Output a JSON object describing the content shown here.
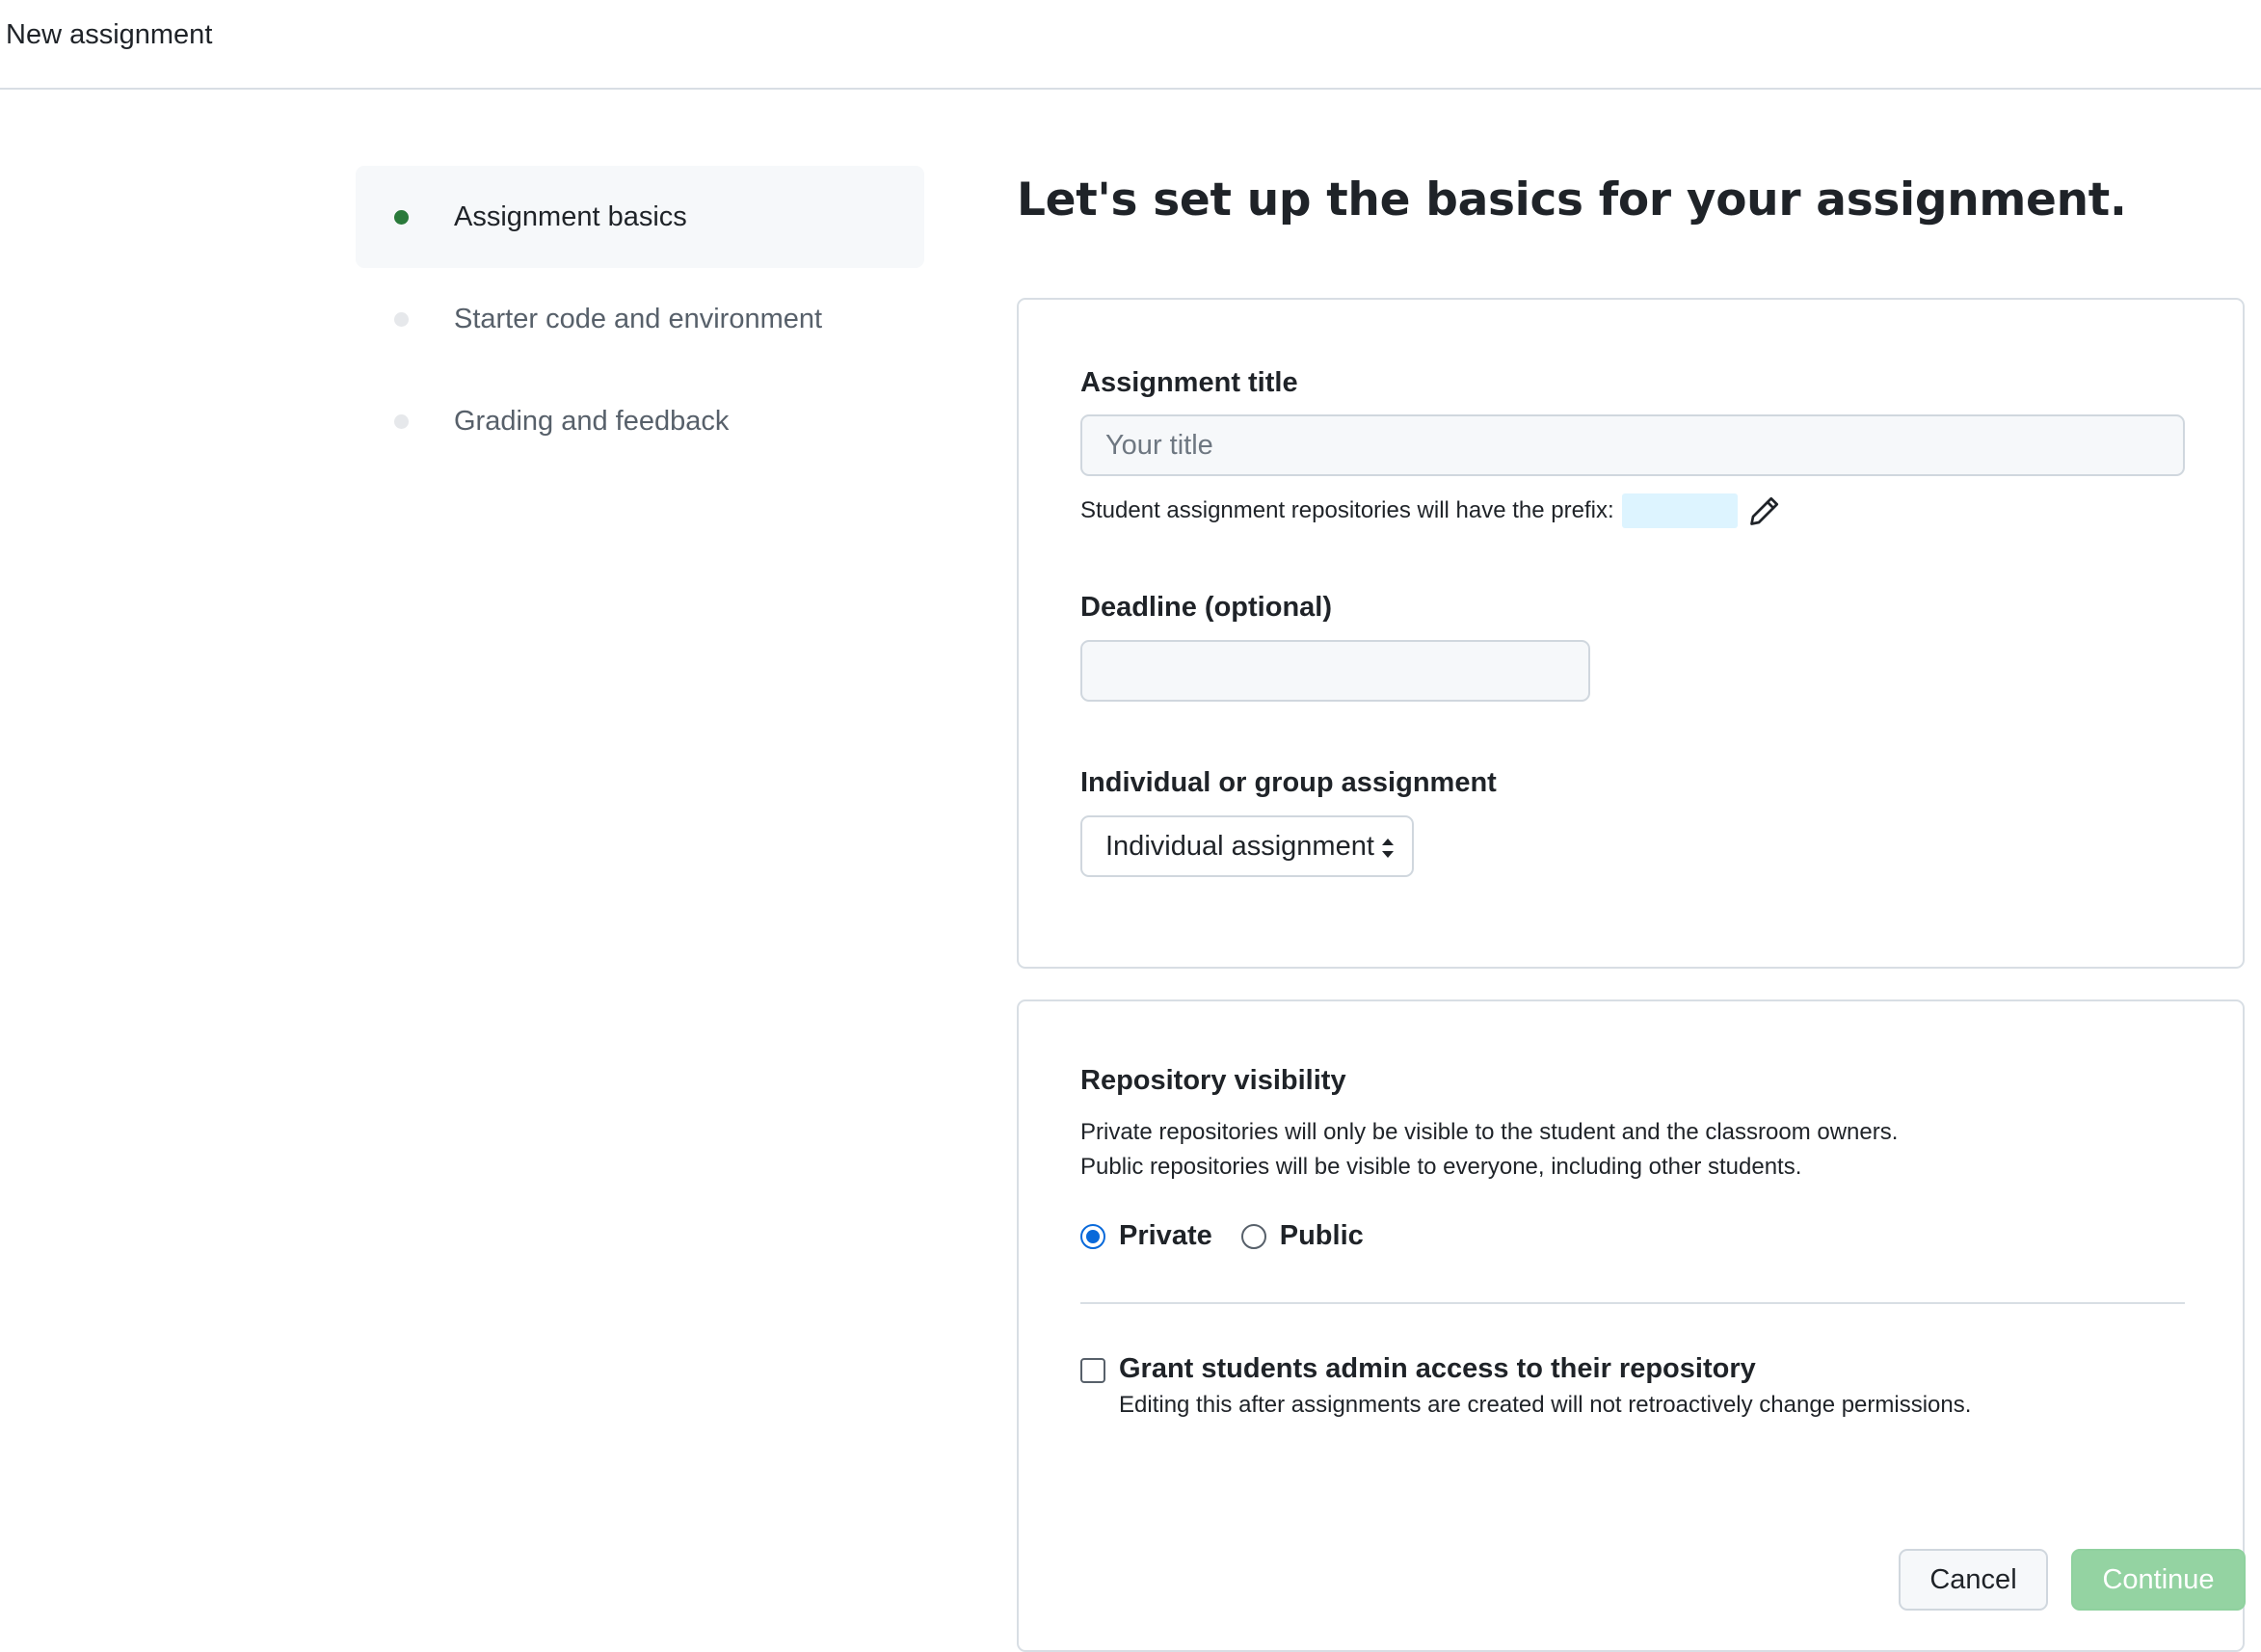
{
  "header": {
    "title": "New assignment"
  },
  "sidebar": {
    "steps": [
      {
        "label": "Assignment basics",
        "active": true
      },
      {
        "label": "Starter code and environment",
        "active": false
      },
      {
        "label": "Grading and feedback",
        "active": false
      }
    ]
  },
  "main": {
    "heading": "Let's set up the basics for your assignment.",
    "title_field": {
      "label": "Assignment title",
      "placeholder": "Your title",
      "value": ""
    },
    "prefix": {
      "text": "Student assignment repositories will have the prefix:",
      "value": ""
    },
    "deadline_field": {
      "label": "Deadline (optional)",
      "value": ""
    },
    "assignment_type": {
      "label": "Individual or group assignment",
      "selected": "Individual assignment"
    },
    "visibility": {
      "label": "Repository visibility",
      "description_line1": "Private repositories will only be visible to the student and the classroom owners.",
      "description_line2": "Public repositories will be visible to everyone, including other students.",
      "options": [
        {
          "label": "Private",
          "checked": true
        },
        {
          "label": "Public",
          "checked": false
        }
      ]
    },
    "admin_access": {
      "label": "Grant students admin access to their repository",
      "help": "Editing this after assignments are created will not retroactively change permissions.",
      "checked": false
    }
  },
  "footer": {
    "cancel_label": "Cancel",
    "continue_label": "Continue"
  },
  "colors": {
    "active_dot": "#2a7a3a",
    "radio_accent": "#0969da",
    "continue_disabled": "#94d3a2",
    "prefix_highlight": "#ddf4ff"
  },
  "icons": {
    "edit_prefix": "pencil-icon",
    "select_arrows": "chevron-up-down-icon"
  }
}
